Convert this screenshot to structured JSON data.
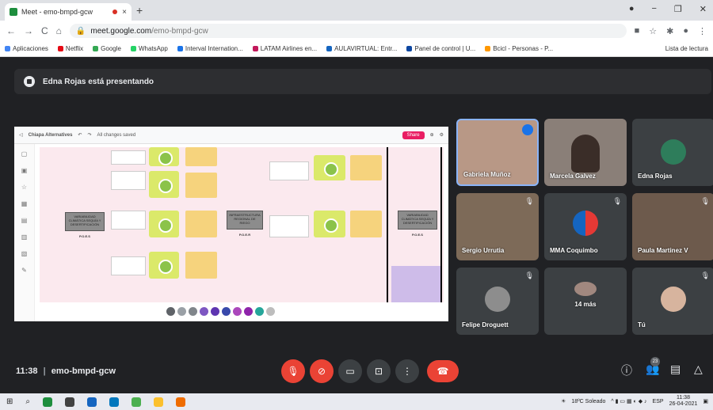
{
  "browser": {
    "tab_title": "Meet - emo-bmpd-gcw",
    "tab_close": "×",
    "new_tab": "+",
    "url_domain": "meet.google.com",
    "url_path": "/emo-bmpd-gcw",
    "window_controls": [
      "●",
      "−",
      "❐",
      "✕"
    ]
  },
  "bookmarks": {
    "items": [
      {
        "label": "Aplicaciones",
        "color": "#4285f4"
      },
      {
        "label": "Netflix",
        "color": "#e50914"
      },
      {
        "label": "Google",
        "color": "#34a853"
      },
      {
        "label": "WhatsApp",
        "color": "#25d366"
      },
      {
        "label": "Interval Internation...",
        "color": "#1a73e8"
      },
      {
        "label": "LATAM Airlines en...",
        "color": "#c2185b"
      },
      {
        "label": "AULAVIRTUAL: Entr...",
        "color": "#1565c0"
      },
      {
        "label": "Panel de control | U...",
        "color": "#0d47a1"
      },
      {
        "label": "Bcicl - Personas - P...",
        "color": "#ff9800"
      }
    ],
    "reading_list": "Lista de lectura"
  },
  "meet": {
    "presenting_text": "Edna Rojas está presentando",
    "meeting_time": "11:38",
    "separator": "|",
    "meeting_code": "emo-bmpd-gcw",
    "participants_badge": "23"
  },
  "shared_screen": {
    "doc_title": "Chiapa Alternatives",
    "saved_status": "All changes saved",
    "share_button": "Share",
    "labels": [
      "VARIABILIDAD CLIMÁTICA SEQUÍA Y DESERTIFICACIÓN",
      "INFRAESTRUCTURA REGIONAL DE RIEGO",
      "VARIABILIDAD CLIMÁTICA SEQUÍA Y DESERTIFICACIÓN"
    ],
    "label_subs": [
      "P.O.E.S",
      "P.O.E.R",
      "P.O.E.S"
    ]
  },
  "participants": [
    {
      "name": "Gabriela Muñoz",
      "speaking": true
    },
    {
      "name": "Marcela Galvez",
      "speaking": false
    },
    {
      "name": "Edna Rojas",
      "speaking": false
    },
    {
      "name": "Sergio Urrutia",
      "speaking": false
    },
    {
      "name": "MMA Coquimbo",
      "speaking": false
    },
    {
      "name": "Paula Martinez V",
      "speaking": false
    },
    {
      "name": "Felipe Droguett",
      "speaking": false
    },
    {
      "name": "14 más",
      "speaking": false
    },
    {
      "name": "Tú",
      "speaking": false
    }
  ],
  "taskbar": {
    "weather": "18ºC Soleado",
    "language": "ESP",
    "time": "11:38",
    "date": "26-04-2021"
  },
  "colors": {
    "meet_bg": "#202124",
    "end_call": "#ea4335",
    "speaking_ring": "#8ab4f8"
  }
}
